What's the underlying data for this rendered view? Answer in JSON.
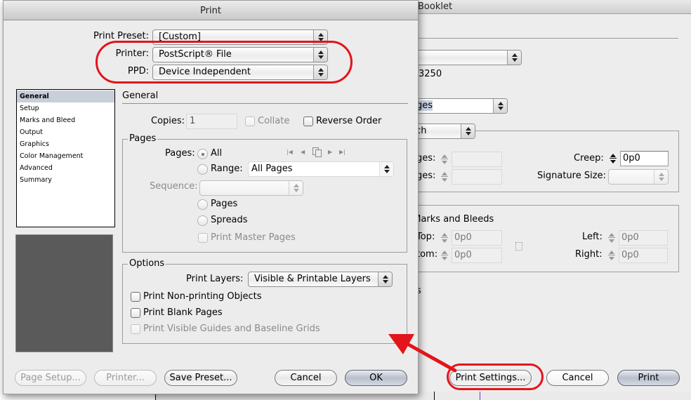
{
  "background_window": {
    "title": "Booklet",
    "printer_select": "",
    "printer_value_partial": "3250",
    "pages_select": "l Pages",
    "binding_select": "Stitch",
    "spacing_label_1": "ges:",
    "spacing_label_2": "ges:",
    "creep_label": "Creep:",
    "creep_value": "0p0",
    "signature_label": "Signature Size:",
    "signature_value": "",
    "marks_title": "t Marks and Bleeds",
    "top_label": "Top:",
    "top_value": "0p0",
    "bottom_label": "tom:",
    "bottom_value": "0p0",
    "left_label": "Left:",
    "left_value": "0p0",
    "right_label": "Right:",
    "right_value": "0p0",
    "truncated_text": "s",
    "buttons": {
      "print_settings": "Print Settings...",
      "cancel": "Cancel",
      "print": "Print"
    }
  },
  "print_dialog": {
    "title": "Print",
    "print_preset_label": "Print Preset:",
    "print_preset_value": "[Custom]",
    "printer_label": "Printer:",
    "printer_value": "PostScript® File",
    "ppd_label": "PPD:",
    "ppd_value": "Device Independent",
    "categories": [
      {
        "label": "General",
        "selected": true
      },
      {
        "label": "Setup",
        "selected": false
      },
      {
        "label": "Marks and Bleed",
        "selected": false
      },
      {
        "label": "Output",
        "selected": false
      },
      {
        "label": "Graphics",
        "selected": false
      },
      {
        "label": "Color Management",
        "selected": false
      },
      {
        "label": "Advanced",
        "selected": false
      },
      {
        "label": "Summary",
        "selected": false
      }
    ],
    "general": {
      "section_title": "General",
      "copies_label": "Copies:",
      "copies_value": "1",
      "collate_label": "Collate",
      "collate_checked": false,
      "reverse_order_label": "Reverse Order",
      "reverse_order_checked": false
    },
    "pages": {
      "group_title": "Pages",
      "pages_label": "Pages:",
      "all_label": "All",
      "all_selected": true,
      "range_label": "Range:",
      "range_value": "All Pages",
      "sequence_label": "Sequence:",
      "sequence_value": "",
      "pages_option_label": "Pages",
      "spreads_option_label": "Spreads",
      "print_master_pages_label": "Print Master Pages",
      "nav_icons": [
        "first-page-icon",
        "previous-page-icon",
        "spread-pages-icon",
        "next-page-icon",
        "last-page-icon"
      ]
    },
    "options": {
      "group_title": "Options",
      "print_layers_label": "Print Layers:",
      "print_layers_value": "Visible & Printable Layers",
      "non_printing_label": "Print Non-printing Objects",
      "blank_pages_label": "Print Blank Pages",
      "guides_label": "Print Visible Guides and Baseline Grids"
    },
    "buttons": {
      "page_setup": "Page Setup...",
      "printer": "Printer...",
      "save_preset": "Save Preset...",
      "cancel": "Cancel",
      "ok": "OK"
    }
  },
  "annotations": {
    "highlight_color": "#e3141c"
  }
}
